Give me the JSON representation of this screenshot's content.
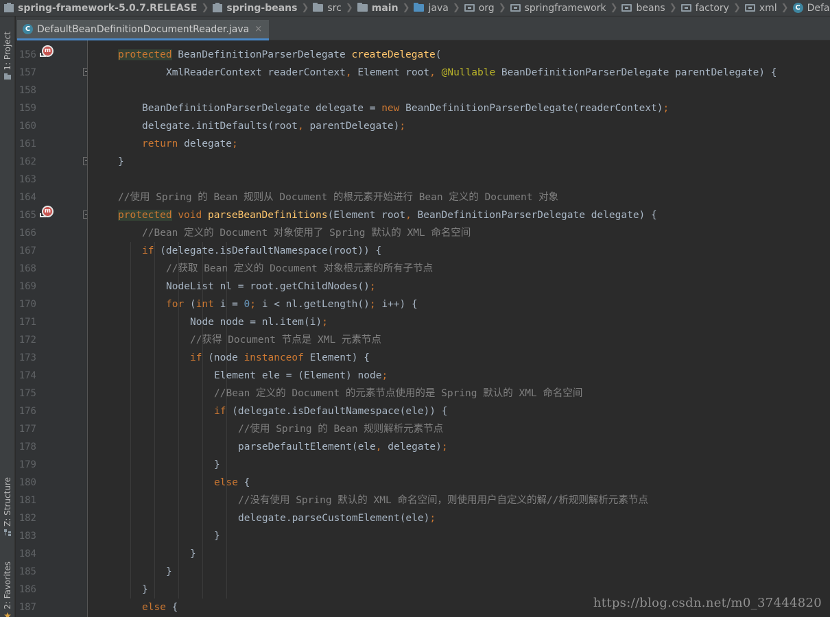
{
  "breadcrumbs": [
    {
      "label": "spring-framework-5.0.7.RELEASE",
      "icon": "module-icon",
      "bold": true
    },
    {
      "label": "spring-beans",
      "icon": "module-icon",
      "bold": true
    },
    {
      "label": "src",
      "icon": "folder-icon",
      "bold": false
    },
    {
      "label": "main",
      "icon": "folder-icon",
      "bold": true
    },
    {
      "label": "java",
      "icon": "source-folder-icon",
      "bold": false
    },
    {
      "label": "org",
      "icon": "package-icon",
      "bold": false
    },
    {
      "label": "springframework",
      "icon": "package-icon",
      "bold": false
    },
    {
      "label": "beans",
      "icon": "package-icon",
      "bold": false
    },
    {
      "label": "factory",
      "icon": "package-icon",
      "bold": false
    },
    {
      "label": "xml",
      "icon": "package-icon",
      "bold": false
    },
    {
      "label": "DefaultBeanDefinitionDocumentReader",
      "icon": "class-icon",
      "bold": false
    }
  ],
  "sidebar": {
    "project_label": "1: Project",
    "structure_label": "Z: Structure",
    "favorites_label": "2: Favorites"
  },
  "tab": {
    "icon_letter": "C",
    "label": "DefaultBeanDefinitionDocumentReader.java",
    "close_glyph": "×"
  },
  "colors": {
    "keyword": "#cc7832",
    "method": "#ffc66d",
    "comment": "#808080",
    "annotation": "#bbb529",
    "number": "#6897bb",
    "text": "#a9b7c6",
    "background": "#2b2b2b"
  },
  "code_lines": [
    {
      "line": "156",
      "marker": true,
      "fold": false,
      "indent": 1,
      "tokens": [
        [
          "kw-hl",
          "protected"
        ],
        [
          "t",
          " BeanDefinitionParserDelegate "
        ],
        [
          "fn",
          "createDelegate"
        ],
        [
          "t",
          "("
        ]
      ]
    },
    {
      "line": "157",
      "marker": false,
      "fold": true,
      "indent": 3,
      "tokens": [
        [
          "t",
          "XmlReaderContext readerContext"
        ],
        [
          "kw",
          ","
        ],
        [
          "t",
          " Element root"
        ],
        [
          "kw",
          ","
        ],
        [
          "t",
          " "
        ],
        [
          "an",
          "@Nullable"
        ],
        [
          "t",
          " BeanDefinitionParserDelegate parentDelegate) {"
        ]
      ]
    },
    {
      "line": "158",
      "marker": false,
      "fold": false,
      "indent": 0,
      "tokens": []
    },
    {
      "line": "159",
      "marker": false,
      "fold": false,
      "indent": 2,
      "tokens": [
        [
          "t",
          "BeanDefinitionParserDelegate delegate = "
        ],
        [
          "kw",
          "new"
        ],
        [
          "t",
          " BeanDefinitionParserDelegate(readerContext)"
        ],
        [
          "kw",
          ";"
        ]
      ]
    },
    {
      "line": "160",
      "marker": false,
      "fold": false,
      "indent": 2,
      "tokens": [
        [
          "t",
          "delegate.initDefaults(root"
        ],
        [
          "kw",
          ","
        ],
        [
          "t",
          " parentDelegate)"
        ],
        [
          "kw",
          ";"
        ]
      ]
    },
    {
      "line": "161",
      "marker": false,
      "fold": false,
      "indent": 2,
      "tokens": [
        [
          "kw",
          "return"
        ],
        [
          "t",
          " delegate"
        ],
        [
          "kw",
          ";"
        ]
      ]
    },
    {
      "line": "162",
      "marker": false,
      "fold": true,
      "indent": 1,
      "tokens": [
        [
          "t",
          "}"
        ]
      ]
    },
    {
      "line": "163",
      "marker": false,
      "fold": false,
      "indent": 0,
      "tokens": []
    },
    {
      "line": "164",
      "marker": false,
      "fold": false,
      "indent": 1,
      "tokens": [
        [
          "cm",
          "//使用 Spring 的 Bean 规则从 Document 的根元素开始进行 Bean 定义的 Document 对象"
        ]
      ]
    },
    {
      "line": "165",
      "marker": true,
      "fold": true,
      "indent": 1,
      "tokens": [
        [
          "kw-hl",
          "protected"
        ],
        [
          "t",
          " "
        ],
        [
          "kw",
          "void"
        ],
        [
          "t",
          " "
        ],
        [
          "fn",
          "parseBeanDefinitions"
        ],
        [
          "t",
          "(Element root"
        ],
        [
          "kw",
          ","
        ],
        [
          "t",
          " BeanDefinitionParserDelegate delegate) {"
        ]
      ]
    },
    {
      "line": "166",
      "marker": false,
      "fold": false,
      "indent": 2,
      "tokens": [
        [
          "cm",
          "//Bean 定义的 Document 对象使用了 Spring 默认的 XML 命名空间"
        ]
      ]
    },
    {
      "line": "167",
      "marker": false,
      "fold": false,
      "indent": 2,
      "tokens": [
        [
          "kw",
          "if"
        ],
        [
          "t",
          " (delegate.isDefaultNamespace(root)) {"
        ]
      ]
    },
    {
      "line": "168",
      "marker": false,
      "fold": false,
      "indent": 3,
      "tokens": [
        [
          "cm",
          "//获取 Bean 定义的 Document 对象根元素的所有子节点"
        ]
      ]
    },
    {
      "line": "169",
      "marker": false,
      "fold": false,
      "indent": 3,
      "tokens": [
        [
          "t",
          "NodeList nl = root.getChildNodes()"
        ],
        [
          "kw",
          ";"
        ]
      ]
    },
    {
      "line": "170",
      "marker": false,
      "fold": false,
      "indent": 3,
      "tokens": [
        [
          "kw",
          "for"
        ],
        [
          "t",
          " ("
        ],
        [
          "kw",
          "int"
        ],
        [
          "t",
          " i = "
        ],
        [
          "nm",
          "0"
        ],
        [
          "kw",
          ";"
        ],
        [
          "t",
          " i < nl.getLength()"
        ],
        [
          "kw",
          ";"
        ],
        [
          "t",
          " i++) {"
        ]
      ]
    },
    {
      "line": "171",
      "marker": false,
      "fold": false,
      "indent": 4,
      "tokens": [
        [
          "t",
          "Node node = nl.item(i)"
        ],
        [
          "kw",
          ";"
        ]
      ]
    },
    {
      "line": "172",
      "marker": false,
      "fold": false,
      "indent": 4,
      "tokens": [
        [
          "cm",
          "//获得 Document 节点是 XML 元素节点"
        ]
      ]
    },
    {
      "line": "173",
      "marker": false,
      "fold": false,
      "indent": 4,
      "tokens": [
        [
          "kw",
          "if"
        ],
        [
          "t",
          " (node "
        ],
        [
          "kw",
          "instanceof"
        ],
        [
          "t",
          " Element) {"
        ]
      ]
    },
    {
      "line": "174",
      "marker": false,
      "fold": false,
      "indent": 5,
      "tokens": [
        [
          "t",
          "Element ele = (Element) node"
        ],
        [
          "kw",
          ";"
        ]
      ]
    },
    {
      "line": "175",
      "marker": false,
      "fold": false,
      "indent": 5,
      "tokens": [
        [
          "cm",
          "//Bean 定义的 Document 的元素节点使用的是 Spring 默认的 XML 命名空间"
        ]
      ]
    },
    {
      "line": "176",
      "marker": false,
      "fold": false,
      "indent": 5,
      "tokens": [
        [
          "kw",
          "if"
        ],
        [
          "t",
          " (delegate.isDefaultNamespace(ele)) {"
        ]
      ]
    },
    {
      "line": "177",
      "marker": false,
      "fold": false,
      "indent": 6,
      "tokens": [
        [
          "cm",
          "//使用 Spring 的 Bean 规则解析元素节点"
        ]
      ]
    },
    {
      "line": "178",
      "marker": false,
      "fold": false,
      "indent": 6,
      "tokens": [
        [
          "t",
          "parseDefaultElement(ele"
        ],
        [
          "kw",
          ","
        ],
        [
          "t",
          " delegate)"
        ],
        [
          "kw",
          ";"
        ]
      ]
    },
    {
      "line": "179",
      "marker": false,
      "fold": false,
      "indent": 5,
      "tokens": [
        [
          "t",
          "}"
        ]
      ]
    },
    {
      "line": "180",
      "marker": false,
      "fold": false,
      "indent": 5,
      "tokens": [
        [
          "kw",
          "else"
        ],
        [
          "t",
          " {"
        ]
      ]
    },
    {
      "line": "181",
      "marker": false,
      "fold": false,
      "indent": 6,
      "tokens": [
        [
          "cm",
          "//没有使用 Spring 默认的 XML 命名空间，则使用用户自定义的解//析规则解析元素节点"
        ]
      ]
    },
    {
      "line": "182",
      "marker": false,
      "fold": false,
      "indent": 6,
      "tokens": [
        [
          "t",
          "delegate.parseCustomElement(ele)"
        ],
        [
          "kw",
          ";"
        ]
      ]
    },
    {
      "line": "183",
      "marker": false,
      "fold": false,
      "indent": 5,
      "tokens": [
        [
          "t",
          "}"
        ]
      ]
    },
    {
      "line": "184",
      "marker": false,
      "fold": false,
      "indent": 4,
      "tokens": [
        [
          "t",
          "}"
        ]
      ]
    },
    {
      "line": "185",
      "marker": false,
      "fold": false,
      "indent": 3,
      "tokens": [
        [
          "t",
          "}"
        ]
      ]
    },
    {
      "line": "186",
      "marker": false,
      "fold": false,
      "indent": 2,
      "tokens": [
        [
          "t",
          "}"
        ]
      ]
    },
    {
      "line": "187",
      "marker": false,
      "fold": false,
      "indent": 2,
      "tokens": [
        [
          "kw",
          "else"
        ],
        [
          "t",
          " {"
        ]
      ]
    }
  ],
  "watermark": "https://blog.csdn.net/m0_37444820"
}
